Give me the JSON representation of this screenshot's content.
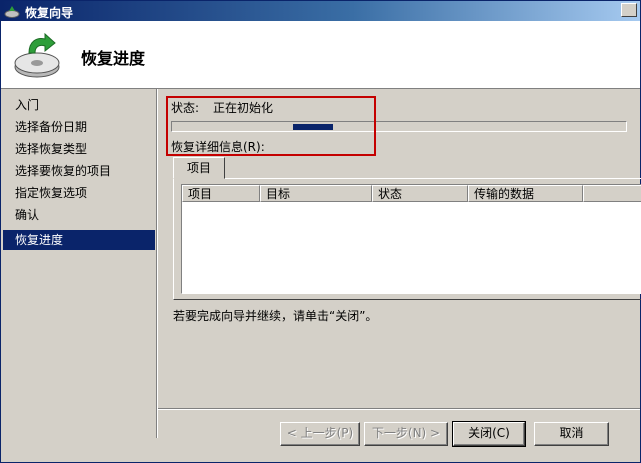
{
  "window": {
    "title": "恢复向导"
  },
  "header": {
    "page_title": "恢复进度"
  },
  "sidebar": {
    "items": [
      {
        "label": "入门"
      },
      {
        "label": "选择备份日期"
      },
      {
        "label": "选择恢复类型"
      },
      {
        "label": "选择要恢复的项目"
      },
      {
        "label": "指定恢复选项"
      },
      {
        "label": "确认"
      },
      {
        "label": "恢复进度",
        "active": true
      }
    ]
  },
  "main": {
    "status_label": "状态:",
    "status_value": "正在初始化",
    "progress": {
      "mode": "indeterminate"
    },
    "details_label": "恢复详细信息(R):",
    "tab_label": "项目",
    "columns": [
      "项目",
      "目标",
      "状态",
      "传输的数据"
    ],
    "rows": [],
    "finish_note": "若要完成向导并继续，请单击“关闭”。"
  },
  "buttons": {
    "back": "< 上一步(P)",
    "next": "下一步(N) >",
    "close": "关闭(C)",
    "cancel": "取消"
  },
  "colors": {
    "selection": "#0a246a",
    "highlight_border": "#c40000",
    "face": "#d4d0c8"
  }
}
